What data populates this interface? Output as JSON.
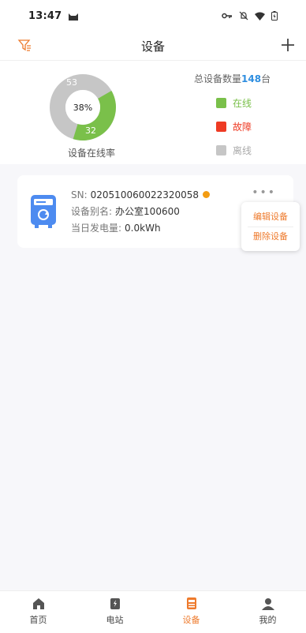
{
  "status_bar": {
    "time": "13:47"
  },
  "header": {
    "title": "设备"
  },
  "summary": {
    "total_label_prefix": "总设备数量",
    "total_count": "148",
    "total_label_suffix": "台",
    "rate_percent": "38%",
    "rate_value": 0.38,
    "online_count": "32",
    "offline_count": "53",
    "rate_label": "设备在线率",
    "legend": [
      {
        "label": "在线",
        "color": "#7ac04a"
      },
      {
        "label": "故障",
        "color": "#ee3b24"
      },
      {
        "label": "离线",
        "color": "#c6c6c6"
      }
    ]
  },
  "device": {
    "sn_label": "SN:",
    "sn": "020510060022320058",
    "alias_label": "设备别名:",
    "alias": "办公室100600",
    "energy_label": "当日发电量:",
    "energy": "0.0kWh",
    "status_color": "#f39c12",
    "menu": {
      "edit": "编辑设备",
      "delete": "删除设备"
    }
  },
  "tabs": [
    {
      "label": "首页",
      "icon": "home-icon"
    },
    {
      "label": "电站",
      "icon": "station-icon"
    },
    {
      "label": "设备",
      "icon": "device-icon",
      "active": true
    },
    {
      "label": "我的",
      "icon": "profile-icon"
    }
  ],
  "colors": {
    "accent": "#ee7a2c",
    "online": "#7ac04a",
    "offline": "#c6c6c6",
    "fault": "#ee3b24",
    "count": "#2e8ee0"
  }
}
